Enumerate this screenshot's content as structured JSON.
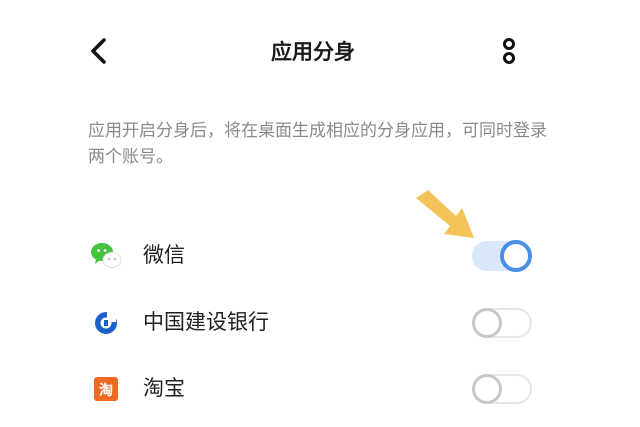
{
  "header": {
    "title": "应用分身",
    "back_icon": "chevron-left-icon",
    "more_icon": "more-vertical-icon"
  },
  "description": "应用开启分身后，将在桌面生成相应的分身应用，可同时登录两个账号。",
  "apps": [
    {
      "name": "微信",
      "icon": "wechat-icon",
      "enabled": true
    },
    {
      "name": "中国建设银行",
      "icon": "ccb-icon",
      "enabled": false
    },
    {
      "name": "淘宝",
      "icon": "taobao-icon",
      "icon_text": "淘",
      "enabled": false
    }
  ],
  "colors": {
    "toggle_on_track": "#d9e8fb",
    "toggle_on_knob": "#4a8fe4",
    "toggle_off_knob": "#c8c8c8",
    "annotation_arrow": "#f3c35a"
  }
}
